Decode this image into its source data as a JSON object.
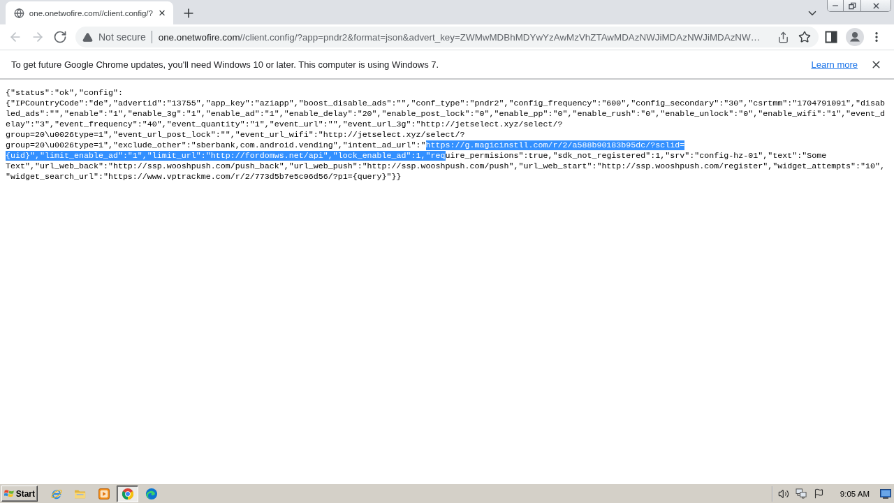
{
  "window": {
    "tabs": [
      {
        "title": "one.onetwofire.com//client.config/?",
        "selected": true
      }
    ]
  },
  "toolbar": {
    "nav_buttons": [
      {
        "kind": "back",
        "disabled": true
      },
      {
        "kind": "forward",
        "disabled": true
      },
      {
        "kind": "reload",
        "disabled": false
      }
    ],
    "address_bar": {
      "security_label": "Not secure",
      "url_host": "one.onetwofire.com",
      "url_rest": "//client.config/?app=pndr2&format=json&advert_key=ZWMwMDBhMDYwYzAwMzVhZTAwMDAzNWJiMDAzNWJiMDAzNW…"
    }
  },
  "infobar": {
    "message": "To get future Google Chrome updates, you'll need Windows 10 or later. This computer is using Windows 7.",
    "link": "Learn more"
  },
  "page": {
    "lines": [
      {
        "segments": [
          {
            "text": "{\"status\":\"ok\",\"config\":",
            "selected": false
          }
        ]
      },
      {
        "segments": [
          {
            "text": "{\"IPCountryCode\":\"de\",\"advertid\":\"13755\",\"app_key\":\"aziapp\",\"boost_disable_ads\":\"\",\"conf_type\":\"pndr2\",\"config_frequency\":\"600\",\"config_secondary\":\"30\",\"csrtmm\":\"1704791091\",\"disab",
            "selected": false
          }
        ]
      },
      {
        "segments": [
          {
            "text": "led_ads\":\"\",\"enable\":\"1\",\"enable_3g\":\"1\",\"enable_ad\":\"1\",\"enable_delay\":\"20\",\"enable_post_lock\":\"0\",\"enable_pp\":\"0\",\"enable_rush\":\"0\",\"enable_unlock\":\"0\",\"enable_wifi\":\"1\",\"event_d",
            "selected": false
          }
        ]
      },
      {
        "segments": [
          {
            "text": "elay\":\"3\",\"event_frequency\":\"40\",\"event_quantity\":\"1\",\"event_url\":\"\",\"event_url_3g\":\"http://jetselect.xyz/select/?",
            "selected": false
          }
        ]
      },
      {
        "segments": [
          {
            "text": "group=20\\u0026type=1\",\"event_url_post_lock\":\"\",\"event_url_wifi\":\"http://jetselect.xyz/select/?",
            "selected": false
          }
        ]
      },
      {
        "segments": [
          {
            "text": "group=20\\u0026type=1\",\"exclude_other\":\"sberbank,com.android.vending\",\"intent_ad_url\":\"",
            "selected": false
          },
          {
            "text": "https://g.magicinstll.com/r/2/a588b90183b95dc/?sclid=",
            "selected": true
          }
        ]
      },
      {
        "segments": [
          {
            "text": "{uid}\",\"limit_enable_ad\":\"1\",\"limit_url\":\"http://fordomws.net/api\",\"lock_enable_ad\":1,\"req",
            "selected": true
          },
          {
            "text": "uire_permisions\":true,\"sdk_not_registered\":1,\"srv\":\"config-hz-01\",\"text\":\"Some",
            "selected": false
          }
        ]
      },
      {
        "segments": [
          {
            "text": "Text\",\"url_web_back\":\"http://ssp.wooshpush.com/push_back\",\"url_web_push\":\"http://ssp.wooshpush.com/push\",\"url_web_start\":\"http://ssp.wooshpush.com/register\",\"widget_attempts\":\"10\",",
            "selected": false
          }
        ]
      },
      {
        "segments": [
          {
            "text": "\"widget_search_url\":\"https://www.vptrackme.com/r/2/773d5b7e5c06d56/?p1={query}\"}}",
            "selected": false
          }
        ]
      }
    ]
  },
  "taskbar": {
    "start": "Start",
    "apps": [
      {
        "kind": "ie",
        "selected": false
      },
      {
        "kind": "explorer",
        "selected": false
      },
      {
        "kind": "media",
        "selected": false
      },
      {
        "kind": "chrome",
        "selected": true
      },
      {
        "kind": "edge",
        "selected": false
      }
    ],
    "clock": "9:05 AM"
  }
}
